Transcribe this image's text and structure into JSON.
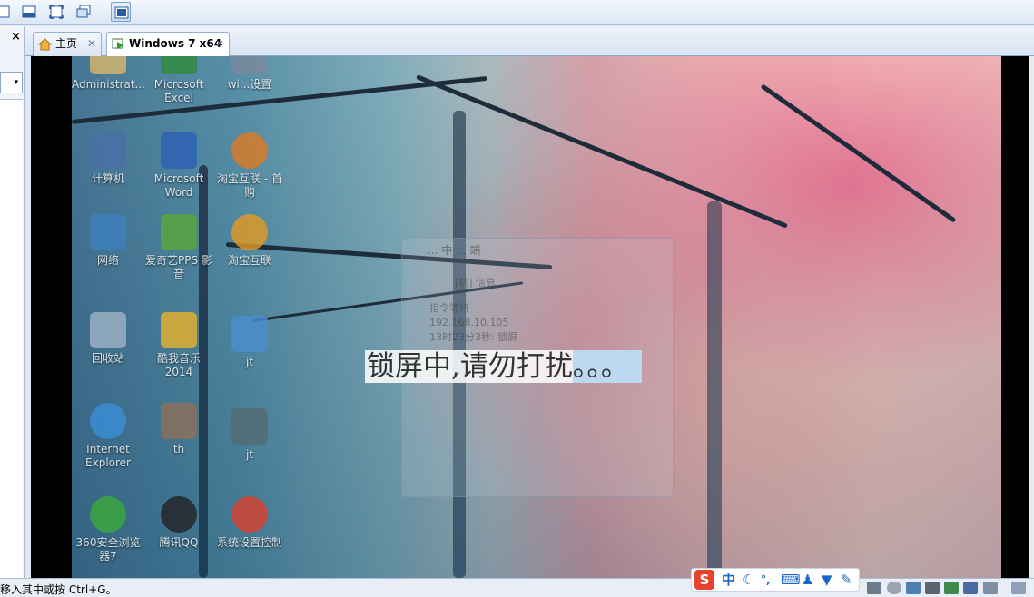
{
  "toolbar": {
    "buttons": [
      "normal-view",
      "fit-window",
      "full-screen",
      "unity",
      "console-view"
    ]
  },
  "left_panel": {
    "close_label": "×",
    "dropdown_arrow": "▾"
  },
  "tabs": [
    {
      "label": "主页",
      "icon": "home-icon",
      "close": "✕"
    },
    {
      "label": "Windows 7 x64",
      "icon": "vm-play-icon",
      "close": "✕"
    }
  ],
  "desktop_icons": [
    {
      "label": "Administrat...",
      "icon": "user-folder-icon"
    },
    {
      "label": "Microsoft Excel",
      "icon": "excel-icon"
    },
    {
      "label": "wi...设置",
      "icon": "settings-icon"
    },
    {
      "label": "计算机",
      "icon": "computer-icon"
    },
    {
      "label": "Microsoft Word",
      "icon": "word-icon"
    },
    {
      "label": "淘宝互联 - 首 购",
      "icon": "taobao-icon"
    },
    {
      "label": "网络",
      "icon": "network-icon"
    },
    {
      "label": "爱奇艺PPS 影音",
      "icon": "iqiyi-icon"
    },
    {
      "label": "淘宝互联",
      "icon": "taobao2-icon"
    },
    {
      "label": "回收站",
      "icon": "recycle-bin-icon"
    },
    {
      "label": "酷我音乐 2014",
      "icon": "kuwo-icon"
    },
    {
      "label": "jt",
      "icon": "image-file-icon"
    },
    {
      "label": "Internet Explorer",
      "icon": "ie-icon"
    },
    {
      "label": "th",
      "icon": "folder-icon"
    },
    {
      "label": "jt",
      "icon": "image-file2-icon"
    },
    {
      "label": "360安全浏览器7",
      "icon": "360-browser-icon"
    },
    {
      "label": "腾讯QQ",
      "icon": "qq-icon"
    },
    {
      "label": "系统设置控制",
      "icon": "system-gear-icon"
    }
  ],
  "ghost_window": {
    "title": "... 中 ... 端",
    "lines": [
      "[机] 信息",
      "指令等待",
      "192.168.10.105",
      "13时23分3秒: 锁屏"
    ]
  },
  "lock_message": {
    "main": "锁屏中,请勿打扰",
    "dots": "。。。"
  },
  "status": {
    "text": "移入其中或按 Ctrl+G。"
  },
  "ime": {
    "logo": "S",
    "mode": "中",
    "items": [
      "moon-icon",
      "punct-icon",
      "keyboard-icon",
      "user-icon",
      "shirt-icon",
      "wrench-icon"
    ]
  },
  "tray": [
    "hdd-icon",
    "cd-icon",
    "network-adapter-icon",
    "printer-icon",
    "sound-icon",
    "usb-icon",
    "display-icon",
    "message-icon"
  ],
  "colors": {
    "accent": "#1b67c7",
    "ime_logo": "#e8412c",
    "lock_highlight": "#bcd9f1"
  }
}
